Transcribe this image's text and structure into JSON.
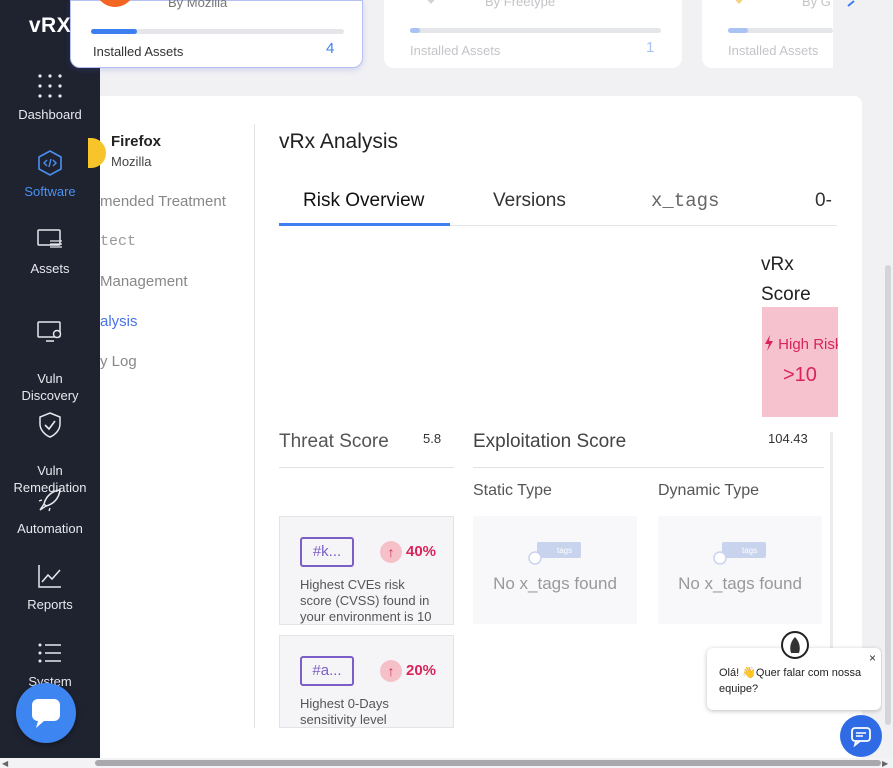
{
  "app": {
    "logo": "vRX"
  },
  "sidebar": {
    "items": [
      {
        "label": "Dashboard",
        "icon": "grid-dots-icon"
      },
      {
        "label": "Software",
        "icon": "code-hexagon-icon",
        "active": true
      },
      {
        "label": "Assets",
        "icon": "monitor-stack-icon"
      },
      {
        "label": "Vuln\nDiscovery",
        "icon": "monitor-search-icon"
      },
      {
        "label": "Vuln\nRemediation",
        "icon": "shield-check-icon"
      },
      {
        "label": "Automation",
        "icon": "rocket-icon"
      },
      {
        "label": "Reports",
        "icon": "chart-line-icon"
      },
      {
        "label": "System",
        "icon": "list-icon"
      }
    ]
  },
  "top_cards": [
    {
      "by": "By Mozilla",
      "label": "Installed Assets",
      "count": "4",
      "selected": true,
      "progress": 0.18
    },
    {
      "by": "By Freetype",
      "label": "Installed Assets",
      "count": "1",
      "selected": false,
      "progress": 0.04
    },
    {
      "by": "By G",
      "label": "Installed Assets",
      "count": "",
      "selected": false,
      "progress": 0.1
    }
  ],
  "software": {
    "name": "Firefox",
    "vendor": "Mozilla"
  },
  "side_menu": {
    "recommended": "mended Treatment",
    "protect": "tect",
    "management": "Management",
    "analysis": "alysis",
    "log": "y Log"
  },
  "analysis": {
    "title": "vRx Analysis",
    "tabs": [
      "Risk Overview",
      "Versions",
      "x_tags",
      "0-"
    ],
    "score_title_1": "vRx",
    "score_title_2": "Score",
    "risk_level": "High Risk",
    "risk_value": ">10",
    "threat_title": "Threat Score",
    "threat_value": "5.8",
    "exploit_title": "Exploitation Score",
    "exploit_value": "104.43",
    "static_type": "Static Type",
    "dynamic_type": "Dynamic Type",
    "no_tags": "No x_tags found",
    "mini_tag": "tags"
  },
  "metrics": [
    {
      "tag": "#k...",
      "pct": "40%",
      "desc": "Highest CVEs risk score (CVSS) found in your environment is 10"
    },
    {
      "tag": "#a...",
      "pct": "20%",
      "desc": "Highest 0-Days sensitivity level"
    }
  ],
  "chat": {
    "message": "Olá! 👋Quer falar com nossa equipe?",
    "close": "×"
  },
  "colors": {
    "accent": "#3d7ff0",
    "sidebar": "#1f2330",
    "risk": "#d9245a",
    "risk_bg": "#f5c2cd",
    "tag": "#7b5fc7"
  }
}
